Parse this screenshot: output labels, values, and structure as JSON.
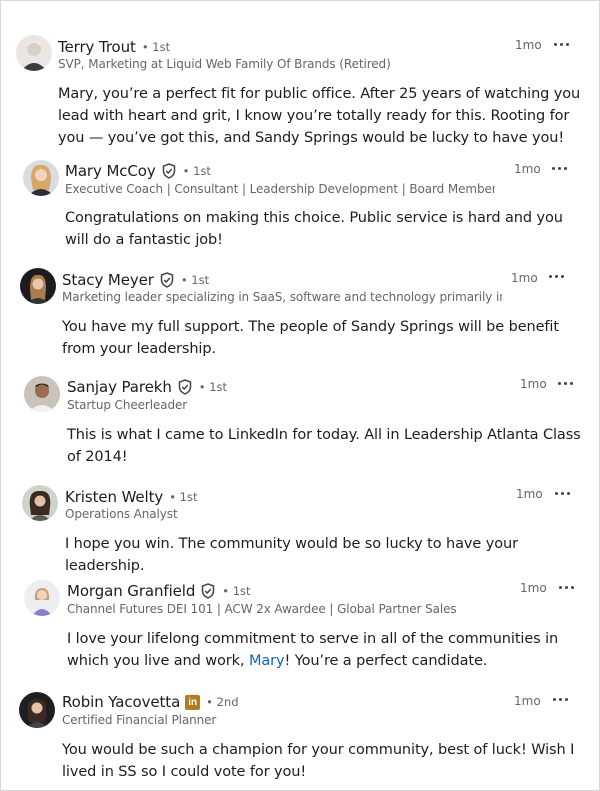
{
  "comments": [
    {
      "name": "Terry Trout",
      "verified": false,
      "premium": false,
      "degree": "1st",
      "headline": "SVP, Marketing at Liquid Web Family Of Brands (Retired)",
      "time": "1mo",
      "text": "Mary, you’re a perfect fit for public office. After 25 years of watching you lead with heart and grit, I know you’re totally ready for this. Rooting for you — you’ve got this, and Sandy Springs would be lucky to have you!"
    },
    {
      "name": "Mary McCoy",
      "verified": true,
      "premium": false,
      "degree": "1st",
      "headline": "Executive Coach | Consultant | Leadership Development | Board Member | ...",
      "time": "1mo",
      "text": "Congratulations on making this choice. Public service is hard and you will do a fantastic job!"
    },
    {
      "name": "Stacy Meyer",
      "verified": true,
      "premium": false,
      "degree": "1st",
      "headline": "Marketing leader specializing in SaaS, software and technology primarily in...",
      "time": "1mo",
      "text": "You have my full support. The people of Sandy Springs will be benefit from your leadership."
    },
    {
      "name": "Sanjay Parekh",
      "verified": true,
      "premium": false,
      "degree": "1st",
      "headline": "Startup Cheerleader",
      "time": "1mo",
      "text": "This is what I came to LinkedIn for today. All in Leadership Atlanta Class of 2014!"
    },
    {
      "name": "Kristen Welty",
      "verified": false,
      "premium": false,
      "degree": "1st",
      "headline": "Operations Analyst",
      "time": "1mo",
      "text": "I hope you win. The community would be so lucky to have your leadership."
    },
    {
      "name": "Morgan Granfield",
      "verified": true,
      "premium": false,
      "degree": "1st",
      "headline": "Channel Futures DEI 101 | ACW 2x Awardee | Global Partner Sales",
      "time": "1mo",
      "text_before": "I love your lifelong commitment to serve in all of the communities in which you live and work, ",
      "mention": "Mary",
      "text_after": "! You’re a perfect candidate."
    },
    {
      "name": "Robin Yacovetta",
      "verified": false,
      "premium": true,
      "premium_label": "in",
      "degree": "2nd",
      "headline": "Certified Financial Planner",
      "time": "1mo",
      "text": "You would be such a champion for your community, best of luck! Wish I lived in SS so I could vote for you!"
    }
  ],
  "colors": {
    "mention": "#0a66c2",
    "premium_badge": "#b47a1f"
  }
}
